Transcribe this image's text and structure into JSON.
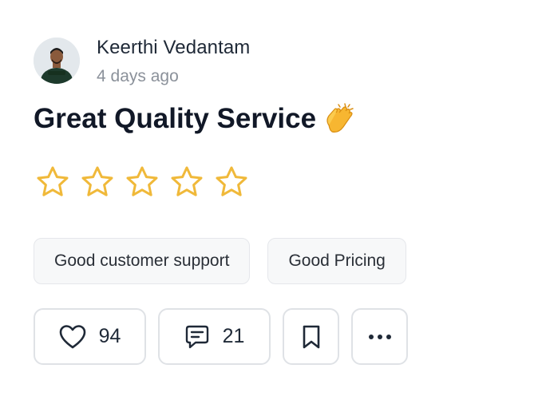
{
  "review": {
    "author_name": "Keerthi Vedantam",
    "timestamp": "4 days ago",
    "title": "Great Quality Service",
    "title_emoji": "clapping-hands",
    "rating": 0,
    "rating_max": 5,
    "tags": [
      "Good customer support",
      "Good Pricing"
    ]
  },
  "actions": {
    "likes": "94",
    "comments": "21"
  },
  "icons": {
    "like": "heart-icon",
    "comment": "comment-icon",
    "bookmark": "bookmark-icon",
    "more": "more-horizontal-icon"
  },
  "colors": {
    "star_outline": "#F0B93A",
    "text_primary": "#111827",
    "text_muted": "#8B919A",
    "border": "#DFE2E6",
    "tag_background": "#F7F8F9"
  }
}
